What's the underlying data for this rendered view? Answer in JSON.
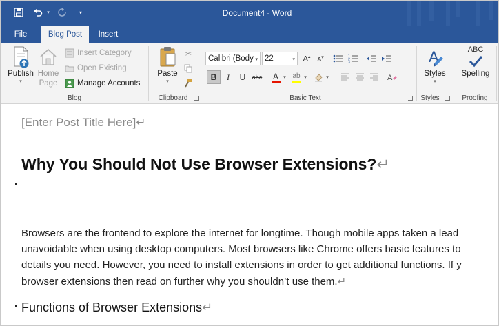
{
  "titlebar": {
    "document_name": "Document4",
    "separator": " - ",
    "app_name": "Word"
  },
  "tabs": [
    {
      "label": "File",
      "active": false
    },
    {
      "label": "Blog Post",
      "active": true
    },
    {
      "label": "Insert",
      "active": false
    }
  ],
  "ribbon": {
    "blog": {
      "publish_label": "Publish",
      "home_page_label": [
        "Home",
        "Page"
      ],
      "insert_category_label": "Insert Category",
      "open_existing_label": "Open Existing",
      "manage_accounts_label": "Manage Accounts",
      "group_label": "Blog"
    },
    "clipboard": {
      "paste_label": "Paste",
      "group_label": "Clipboard"
    },
    "basic_text": {
      "font_name": "Calibri (Body",
      "font_size": "22",
      "bold_label": "B",
      "italic_label": "I",
      "underline_label": "U",
      "strike_label": "abc",
      "font_color_label": "A",
      "group_label": "Basic Text"
    },
    "styles": {
      "styles_label": "Styles",
      "group_label": "Styles"
    },
    "proofing": {
      "abc_label": "ABC",
      "spelling_label": "Spelling",
      "group_label": "Proofing"
    }
  },
  "colors": {
    "accent": "#2b579a",
    "ribbon_bg": "#f3f3f3",
    "font_color": "#e51400",
    "highlight_color": "#ffff00"
  },
  "document": {
    "post_title_placeholder": "[Enter Post Title Here]",
    "heading": "Why You Should Not Use Browser Extensions?",
    "paragraph_lines": [
      "Browsers are the frontend to explore the internet for longtime. Though mobile apps taken a lead",
      "unavoidable when using desktop computers. Most browsers like Chrome offers basic features to",
      "details you need. However, you need to install extensions in order to get additional functions. If y",
      "browser extensions then read on further why you shouldn’t use them."
    ],
    "subheading": "Functions of Browser Extensions",
    "paragraph_mark": "↵"
  }
}
